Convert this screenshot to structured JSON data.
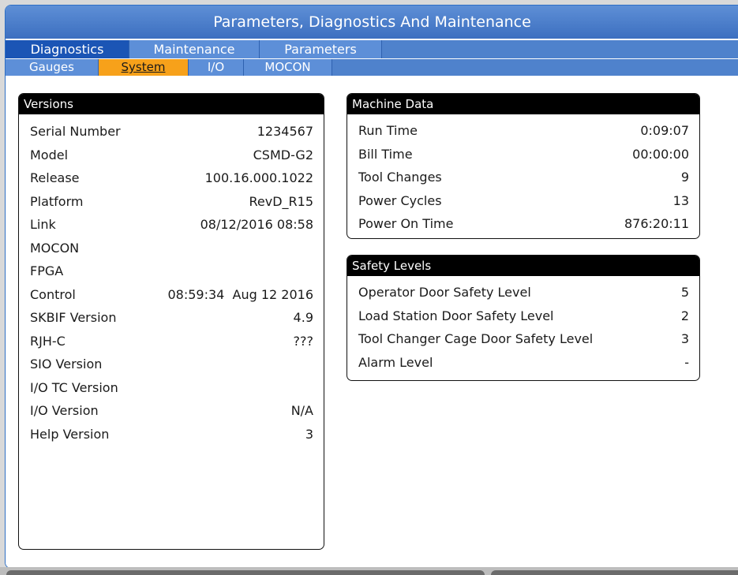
{
  "title": "Parameters, Diagnostics And Maintenance",
  "main_tabs": [
    "Diagnostics",
    "Maintenance",
    "Parameters"
  ],
  "main_tab_active": "Diagnostics",
  "sub_tabs": [
    "Gauges",
    "System",
    "I/O",
    "MOCON"
  ],
  "sub_tab_active": "System",
  "versions": {
    "title": "Versions",
    "rows": [
      {
        "label": "Serial Number",
        "value": "1234567"
      },
      {
        "label": "Model",
        "value": "CSMD-G2"
      },
      {
        "label": "Release",
        "value": "100.16.000.1022"
      },
      {
        "label": "Platform",
        "value": "RevD_R15"
      },
      {
        "label": "Link",
        "value": "08/12/2016 08:58"
      },
      {
        "label": "MOCON",
        "value": ""
      },
      {
        "label": "FPGA",
        "value": ""
      },
      {
        "label": "Control",
        "value": "08:59:34  Aug 12 2016"
      },
      {
        "label": "SKBIF Version",
        "value": "4.9"
      },
      {
        "label": "RJH-C",
        "value": "???"
      },
      {
        "label": "SIO Version",
        "value": ""
      },
      {
        "label": "I/O TC Version",
        "value": ""
      },
      {
        "label": "I/O Version",
        "value": "N/A"
      },
      {
        "label": "Help Version",
        "value": "3"
      }
    ]
  },
  "machine_data": {
    "title": "Machine Data",
    "rows": [
      {
        "label": "Run Time",
        "value": "0:09:07"
      },
      {
        "label": "Bill Time",
        "value": "00:00:00"
      },
      {
        "label": "Tool Changes",
        "value": "9"
      },
      {
        "label": "Power Cycles",
        "value": "13"
      },
      {
        "label": "Power On Time",
        "value": "876:20:11"
      }
    ]
  },
  "safety_levels": {
    "title": "Safety Levels",
    "rows": [
      {
        "label": "Operator Door Safety Level",
        "value": "5"
      },
      {
        "label": "Load Station Door Safety Level",
        "value": "2"
      },
      {
        "label": "Tool Changer Cage Door Safety Level",
        "value": "3"
      },
      {
        "label": "Alarm Level",
        "value": "-"
      }
    ]
  },
  "colors": {
    "title_bar": "#4a7cc9",
    "active_main_tab": "#1b55b5",
    "active_sub_tab": "#f7a11a",
    "panel_header": "#000000"
  }
}
